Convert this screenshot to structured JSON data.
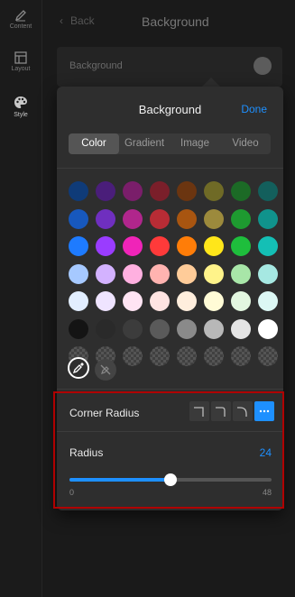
{
  "rail": {
    "items": [
      {
        "label": "Content",
        "icon": "pencil-icon"
      },
      {
        "label": "Layout",
        "icon": "layout-icon"
      },
      {
        "label": "Style",
        "icon": "palette-icon"
      }
    ]
  },
  "header": {
    "back": "Back",
    "title": "Background"
  },
  "background_row": {
    "label": "Background"
  },
  "popover": {
    "title": "Background",
    "done": "Done",
    "tabs": [
      "Color",
      "Gradient",
      "Image",
      "Video"
    ],
    "selected_tab": "Color",
    "swatches": [
      [
        "#0f3b78",
        "#4a1e7a",
        "#7a1e6a",
        "#7a1f2a",
        "#6b3510",
        "#6f6a26",
        "#1c6a26",
        "#135f5c"
      ],
      [
        "#1758bd",
        "#6f2fbf",
        "#b0268c",
        "#b82c35",
        "#a85510",
        "#9c8a3c",
        "#1e9a30",
        "#10938c"
      ],
      [
        "#1e7bff",
        "#9a3cff",
        "#f024b8",
        "#ff3a3a",
        "#ff7d08",
        "#ffe61a",
        "#1ebe3c",
        "#14bfb5"
      ],
      [
        "#a6c9ff",
        "#d3b2ff",
        "#ffb0e0",
        "#ffb3b0",
        "#ffcc99",
        "#fff38a",
        "#a8e6a8",
        "#a6e8e2"
      ],
      [
        "#e2eeff",
        "#efe4ff",
        "#ffe4f3",
        "#ffe4e2",
        "#ffeedd",
        "#fffbd6",
        "#e3f7e0",
        "#dcf7f4"
      ],
      [
        "#141414",
        "#2a2a2a",
        "#3c3c3c",
        "#5a5a5a",
        "#8a8a8a",
        "#b8b8b8",
        "#e4e4e4",
        "#ffffff"
      ]
    ],
    "transparent_row_count": 8,
    "tools": [
      {
        "icon": "eyedropper-icon"
      },
      {
        "icon": "eyedropper-disabled-icon"
      }
    ],
    "corner_radius": {
      "label": "Corner Radius",
      "options": [
        "square-corner-icon",
        "round-corner-icon",
        "rounder-corner-icon",
        "more-icon"
      ],
      "selected_index": 3
    },
    "radius": {
      "label": "Radius",
      "value": "24",
      "min": "0",
      "max": "48",
      "fraction": 0.5
    }
  },
  "colors": {
    "accent": "#1e90ff",
    "highlight": "#b00000"
  }
}
